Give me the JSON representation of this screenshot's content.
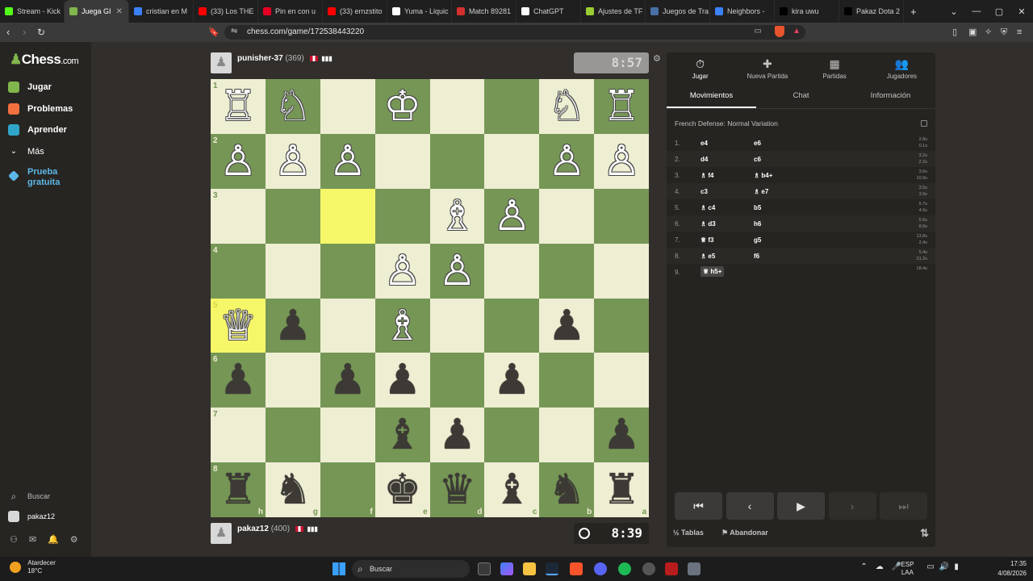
{
  "browser": {
    "tabs": [
      {
        "label": "Stream - Kick",
        "color": "#53fc18"
      },
      {
        "label": "Juega GI",
        "color": "#81b64c",
        "active": true
      },
      {
        "label": "cristian en M",
        "color": "#3b82f6"
      },
      {
        "label": "(33) Los THE",
        "color": "#ff0000"
      },
      {
        "label": "Pin en con u",
        "color": "#e60023"
      },
      {
        "label": "(33) ernzstito",
        "color": "#ff0000"
      },
      {
        "label": "Yuma - Liquic",
        "color": "#ffffff"
      },
      {
        "label": "Match 89281",
        "color": "#d32f2f"
      },
      {
        "label": "ChatGPT",
        "color": "#ffffff"
      },
      {
        "label": "Ajustes de TF",
        "color": "#9acd32"
      },
      {
        "label": "Juegos de Tra",
        "color": "#4a6fa5"
      },
      {
        "label": "Neighbors -",
        "color": "#3b82f6"
      },
      {
        "label": "kira uwu",
        "color": "#000000"
      },
      {
        "label": "Pakaz Dota 2",
        "color": "#000000"
      }
    ],
    "new_tab": "+",
    "url": "chess.com/game/172538443220"
  },
  "sidebar": {
    "logo_main": "Chess",
    "logo_suffix": ".com",
    "items": [
      {
        "label": "Jugar",
        "color": "#81b64c"
      },
      {
        "label": "Problemas",
        "color": "#f2703e"
      },
      {
        "label": "Aprender",
        "color": "#2fa6c9"
      },
      {
        "label": "Más",
        "color": "transparent"
      }
    ],
    "promo": "Prueba gratuita",
    "promo_line1": "Prueba",
    "promo_line2": "gratuita",
    "search": "Buscar",
    "user": "pakaz12"
  },
  "top_player": {
    "name": "punisher-37",
    "rating": "(369)",
    "clock": "8:57"
  },
  "bottom_player": {
    "name": "pakaz12",
    "rating": "(400)",
    "clock": "8:39"
  },
  "board": {
    "orientation": "black",
    "ranks": [
      "1",
      "2",
      "3",
      "4",
      "5",
      "6",
      "7",
      "8"
    ],
    "files": [
      "h",
      "g",
      "f",
      "e",
      "d",
      "c",
      "b",
      "a"
    ],
    "highlight": [
      "f3",
      "h5"
    ],
    "pieces": [
      {
        "sq": "h1",
        "p": "♖",
        "c": "w"
      },
      {
        "sq": "g1",
        "p": "♘",
        "c": "w"
      },
      {
        "sq": "e1",
        "p": "♔",
        "c": "w"
      },
      {
        "sq": "b1",
        "p": "♘",
        "c": "w"
      },
      {
        "sq": "a1",
        "p": "♖",
        "c": "w"
      },
      {
        "sq": "h2",
        "p": "♙",
        "c": "w"
      },
      {
        "sq": "g2",
        "p": "♙",
        "c": "w"
      },
      {
        "sq": "f2",
        "p": "♙",
        "c": "w"
      },
      {
        "sq": "b2",
        "p": "♙",
        "c": "w"
      },
      {
        "sq": "a2",
        "p": "♙",
        "c": "w"
      },
      {
        "sq": "d3",
        "p": "♗",
        "c": "w"
      },
      {
        "sq": "c3",
        "p": "♙",
        "c": "w"
      },
      {
        "sq": "e4",
        "p": "♙",
        "c": "w"
      },
      {
        "sq": "d4",
        "p": "♙",
        "c": "w"
      },
      {
        "sq": "h5",
        "p": "♕",
        "c": "w"
      },
      {
        "sq": "g5",
        "p": "♟",
        "c": "b"
      },
      {
        "sq": "e5",
        "p": "♗",
        "c": "w"
      },
      {
        "sq": "b5",
        "p": "♟",
        "c": "b"
      },
      {
        "sq": "h6",
        "p": "♟",
        "c": "b"
      },
      {
        "sq": "f6",
        "p": "♟",
        "c": "b"
      },
      {
        "sq": "e6",
        "p": "♟",
        "c": "b"
      },
      {
        "sq": "c6",
        "p": "♟",
        "c": "b"
      },
      {
        "sq": "e7",
        "p": "♝",
        "c": "b"
      },
      {
        "sq": "d7",
        "p": "♟",
        "c": "b"
      },
      {
        "sq": "a7",
        "p": "♟",
        "c": "b"
      },
      {
        "sq": "h8",
        "p": "♜",
        "c": "b"
      },
      {
        "sq": "g8",
        "p": "♞",
        "c": "b"
      },
      {
        "sq": "e8",
        "p": "♚",
        "c": "b"
      },
      {
        "sq": "d8",
        "p": "♛",
        "c": "b"
      },
      {
        "sq": "c8",
        "p": "♝",
        "c": "b"
      },
      {
        "sq": "b8",
        "p": "♞",
        "c": "b"
      },
      {
        "sq": "a8",
        "p": "♜",
        "c": "b"
      }
    ]
  },
  "panel": {
    "topnav": [
      {
        "label": "Jugar",
        "icon": "⏱",
        "name": "play"
      },
      {
        "label": "Nueva Partida",
        "icon": "✚",
        "name": "new-game"
      },
      {
        "label": "Partidas",
        "icon": "▦",
        "name": "games"
      },
      {
        "label": "Jugadores",
        "icon": "👥",
        "name": "players"
      }
    ],
    "subtabs": [
      "Movimientos",
      "Chat",
      "Información"
    ],
    "opening": "French Defense: Normal Variation",
    "moves": [
      {
        "n": "1.",
        "w": "e4",
        "b": "e6",
        "tw": "2.8s",
        "tb": "0.1s"
      },
      {
        "n": "2.",
        "w": "d4",
        "b": "c6",
        "tw": "3.2s",
        "tb": "2.2s"
      },
      {
        "n": "3.",
        "w": "♗ f4",
        "b": "♗ b4+",
        "tw": "3.6s",
        "tb": "10.9s"
      },
      {
        "n": "4.",
        "w": "c3",
        "b": "♗ e7",
        "tw": "3.5s",
        "tb": "3.9s"
      },
      {
        "n": "5.",
        "w": "♗ c4",
        "b": "b5",
        "tw": "5.7s",
        "tb": "4.6s"
      },
      {
        "n": "6.",
        "w": "♗ d3",
        "b": "h6",
        "tw": "5.6s",
        "tb": "8.8s"
      },
      {
        "n": "7.",
        "w": "♕ f3",
        "b": "g5",
        "tw": "13.8s",
        "tb": "2.4s"
      },
      {
        "n": "8.",
        "w": "♗ e5",
        "b": "f6",
        "tw": "5.4s",
        "tb": "31.2s"
      },
      {
        "n": "9.",
        "w": "♕ h5+",
        "b": "",
        "tw": "18.4s",
        "tb": ""
      }
    ],
    "controls": [
      "⏮",
      "‹",
      "▶",
      "›",
      "⏭"
    ],
    "draw": "½ Tablas",
    "resign": "⚑ Abandonar",
    "flip": "⇅"
  },
  "taskbar": {
    "weather_label": "Atardecer",
    "weather_temp": "18°C",
    "search": "Buscar",
    "lang1": "ESP",
    "lang2": "LAA",
    "time": "17:35",
    "date": "4/08/2026"
  }
}
